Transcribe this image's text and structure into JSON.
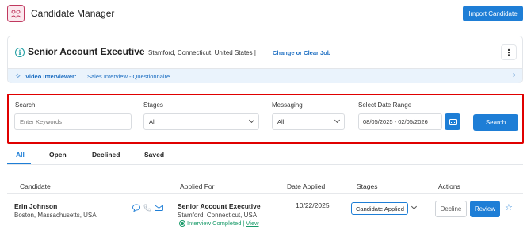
{
  "header": {
    "app_title": "Candidate Manager",
    "import_button": "Import Candidate",
    "logo_icon": "logo-icon"
  },
  "job": {
    "title": "Senior Account Executive",
    "location": "Stamford, Connecticut, United States |",
    "change_link": "Change or Clear Job",
    "more_icon": "kebab-menu-icon"
  },
  "video_interviewer": {
    "label": "Video Interviewer:",
    "value": "Sales Interview - Questionnaire"
  },
  "filters": {
    "search_label": "Search",
    "search_placeholder": "Enter Keywords",
    "stages_label": "Stages",
    "stages_value": "All",
    "messaging_label": "Messaging",
    "messaging_value": "All",
    "date_label": "Select Date Range",
    "date_value": "08/05/2025 - 02/05/2026",
    "search_button": "Search"
  },
  "tabs": [
    {
      "label": "All",
      "active": true
    },
    {
      "label": "Open",
      "active": false
    },
    {
      "label": "Declined",
      "active": false
    },
    {
      "label": "Saved",
      "active": false
    }
  ],
  "table": {
    "headers": [
      "Candidate",
      "Applied For",
      "Date Applied",
      "Stages",
      "Actions"
    ],
    "rows": [
      {
        "name": "Erin Johnson",
        "location": "Boston, Massachusetts, USA",
        "applied_for": "Senior Account Executive",
        "applied_location": "Stamford, Connecticut, USA",
        "interview_status": "Interview Completed |",
        "view_link": "View",
        "date_applied": "10/22/2025",
        "stage": "Candidate Applied",
        "decline": "Decline",
        "review": "Review"
      }
    ]
  },
  "colors": {
    "primary": "#1e7ed6",
    "highlight_border": "#e00000",
    "success": "#1a9b6a",
    "teal": "#1a9ba0"
  }
}
